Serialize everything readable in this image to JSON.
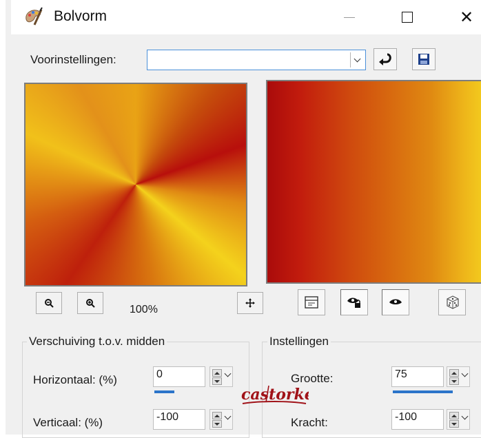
{
  "window": {
    "title": "Bolvorm",
    "minimize_icon": "minimize-icon",
    "maximize_icon": "maximize-icon",
    "close_glyph": "✕"
  },
  "presets": {
    "label": "Voorinstellingen:",
    "value": ""
  },
  "zoom": {
    "level": "100%"
  },
  "offset_group": {
    "title": "Verschuiving t.o.v. midden",
    "horizontal_label": "Horizontaal: (%)",
    "horizontal_value": "0",
    "horizontal_fill": 0.5,
    "vertical_label": "Verticaal: (%)",
    "vertical_value": "-100"
  },
  "settings_group": {
    "title": "Instellingen",
    "size_label": "Grootte:",
    "size_value": "75",
    "size_fill": 0.75,
    "strength_label": "Kracht:",
    "strength_value": "-100"
  },
  "watermark": {
    "text": "castorke"
  },
  "colors": {
    "accent": "#2b74c9",
    "gradient_dark": "#aa0b0b",
    "gradient_light": "#f4d21c"
  }
}
